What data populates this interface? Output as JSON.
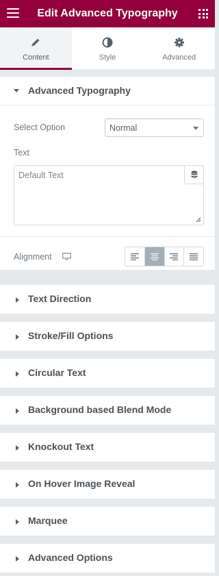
{
  "header": {
    "title": "Edit Advanced Typography",
    "menu_icon": "hamburger-icon",
    "widgets_icon": "grid-icon",
    "color": "#93003c"
  },
  "tabs": [
    {
      "label": "Content",
      "icon": "pencil-icon",
      "active": true
    },
    {
      "label": "Style",
      "icon": "half-circle-icon",
      "active": false
    },
    {
      "label": "Advanced",
      "icon": "gear-icon",
      "active": false
    }
  ],
  "open_section": {
    "title": "Advanced Typography",
    "select_option": {
      "label": "Select Option",
      "value": "Normal"
    },
    "text": {
      "label": "Text",
      "placeholder": "Default Text"
    },
    "alignment": {
      "label": "Alignment",
      "options": [
        "left",
        "center",
        "right",
        "justify"
      ],
      "selected": "center"
    }
  },
  "sections": [
    {
      "title": "Text Direction"
    },
    {
      "title": "Stroke/Fill Options"
    },
    {
      "title": "Circular Text"
    },
    {
      "title": "Background based Blend Mode"
    },
    {
      "title": "Knockout Text"
    },
    {
      "title": "On Hover Image Reveal"
    },
    {
      "title": "Marquee"
    },
    {
      "title": "Advanced Options"
    }
  ]
}
